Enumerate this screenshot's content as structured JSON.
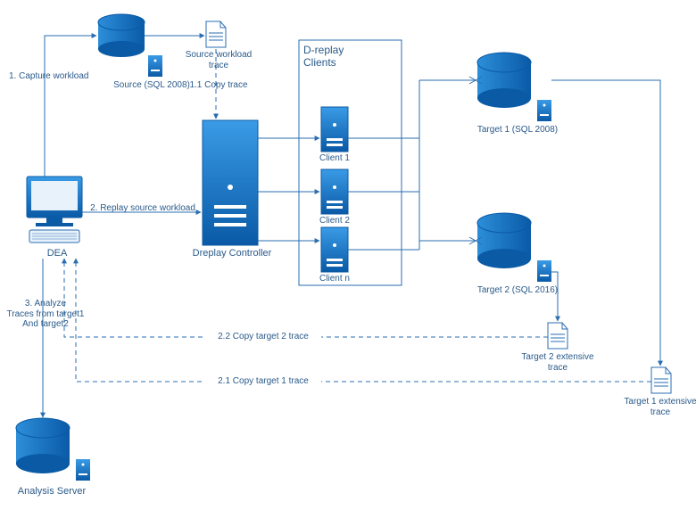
{
  "nodes": {
    "source": "Source (SQL 2008)",
    "source_trace": "Source workload\ntrace",
    "dea": "DEA",
    "dreplay_controller": "Dreplay Controller",
    "dreplay_box_title": "D-replay\nClients",
    "client1": "Client 1",
    "client2": "Client 2",
    "clientn": "Client n",
    "target1": "Target 1 (SQL 2008)",
    "target2": "Target 2 (SQL 2016)",
    "target1_trace": "Target 1 extensive\ntrace",
    "target2_trace": "Target 2 extensive\ntrace",
    "analysis_server": "Analysis Server"
  },
  "edges": {
    "capture": "1. Capture workload",
    "copy_trace": "1.1 Copy trace",
    "replay": "2. Replay source workload",
    "copy_t1": "2.1 Copy target 1 trace",
    "copy_t2": "2.2 Copy target 2 trace",
    "analyze": "3. Analyze\nTraces from target1\nAnd target2"
  },
  "colors": {
    "stroke": "#2a6db0",
    "fill_light": "#7db3e0",
    "fill_dark": "#0e5ba3",
    "text": "#2a5a8a"
  }
}
